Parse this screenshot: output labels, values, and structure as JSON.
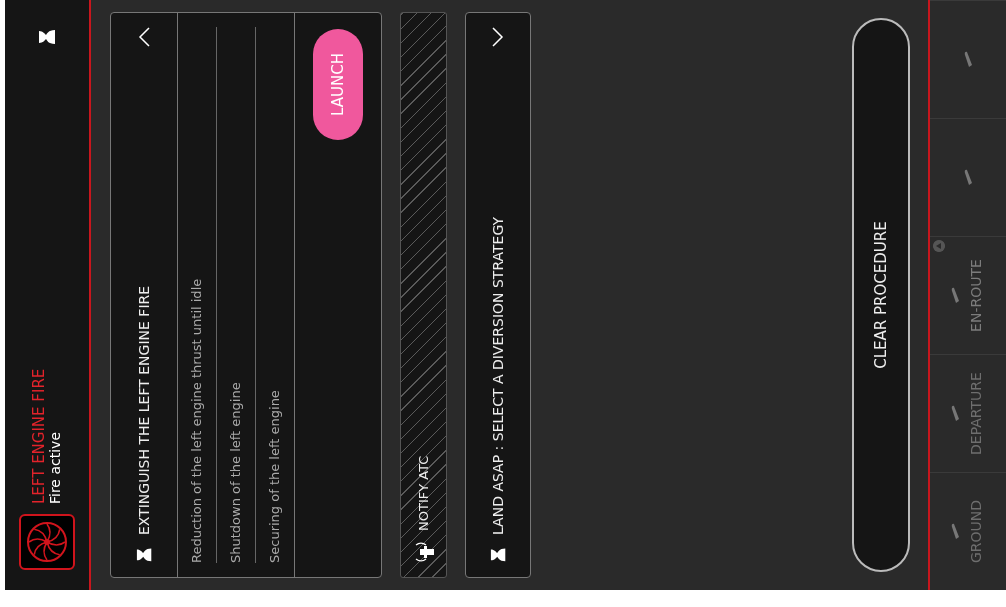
{
  "header": {
    "title": "LEFT ENGINE FIRE",
    "subtitle": "Fire active"
  },
  "procedures": [
    {
      "kind": "checklist",
      "title": "EXTINGUISH THE LEFT ENGINE FIRE",
      "expanded": true,
      "steps": [
        "Reduction of the left engine thrust until idle",
        "Shutdown of the left engine",
        "Securing of the left engine"
      ],
      "action": "LAUNCH"
    },
    {
      "kind": "communication",
      "title": "NOTIFY ATC"
    },
    {
      "kind": "checklist",
      "title": "LAND ASAP : SELECT A DIVERSION STRATEGY",
      "expanded": false
    }
  ],
  "clear_button": "CLEAR PROCEDURE",
  "phases": [
    {
      "label": "GROUND",
      "selected": false
    },
    {
      "label": "DEPARTURE",
      "selected": false
    },
    {
      "label": "EN-ROUTE",
      "selected": true
    },
    {
      "selected": false
    },
    {
      "selected": false
    }
  ]
}
